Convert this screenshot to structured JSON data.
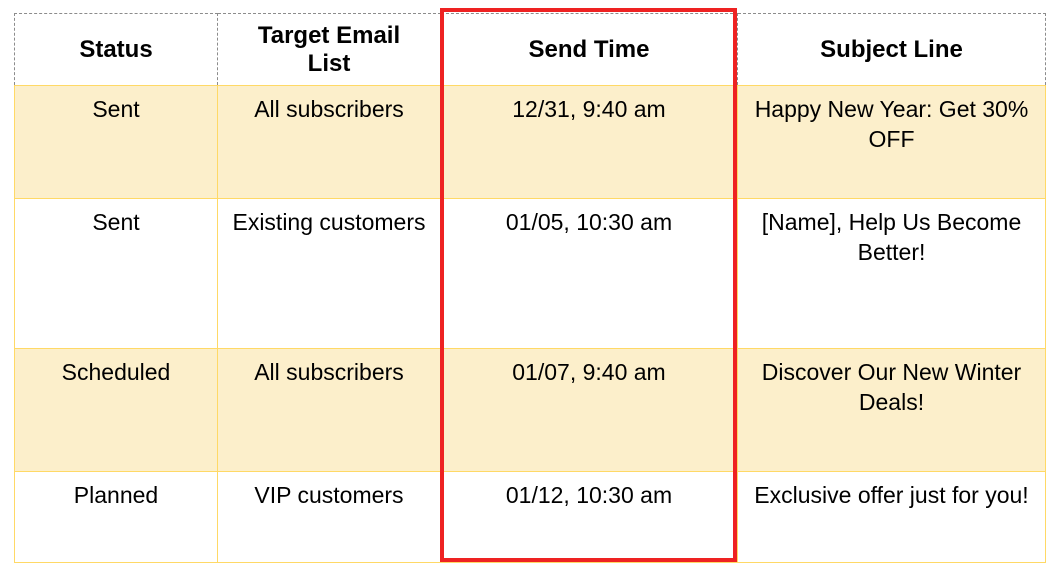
{
  "table": {
    "columns": [
      {
        "key": "status",
        "label": "Status"
      },
      {
        "key": "list",
        "label": "Target Email\nList"
      },
      {
        "key": "time",
        "label": "Send Time"
      },
      {
        "key": "subject",
        "label": "Subject Line"
      }
    ],
    "headers": {
      "status": "Status",
      "list": "Target Email List",
      "list_line1": "Target Email",
      "list_line2": "List",
      "time": "Send Time",
      "subject": "Subject Line"
    },
    "rows": [
      {
        "status": "Sent",
        "list": "All subscribers",
        "time": "12/31, 9:40 am",
        "subject": "Happy New Year: Get 30% OFF",
        "shaded": true
      },
      {
        "status": "Sent",
        "list": "Existing customers",
        "time": "01/05, 10:30 am",
        "subject": "[Name], Help Us Become Better!",
        "shaded": false
      },
      {
        "status": "Scheduled",
        "list": "All subscribers",
        "time": "01/07, 9:40 am",
        "subject": "Discover Our New Winter Deals!",
        "shaded": true
      },
      {
        "status": "Planned",
        "list": "VIP customers",
        "time": "01/12, 10:30 am",
        "subject": "Exclusive offer just for you!",
        "shaded": false
      }
    ]
  },
  "highlight": {
    "target_column": "Send Time",
    "color": "#ee2222"
  },
  "colors": {
    "shaded_row_background": "#fcefcb",
    "plain_row_background": "#ffffff",
    "cell_border": "#ffd966",
    "header_border": "#8c8c8c",
    "highlight_border": "#ee2222",
    "text": "#000000"
  }
}
